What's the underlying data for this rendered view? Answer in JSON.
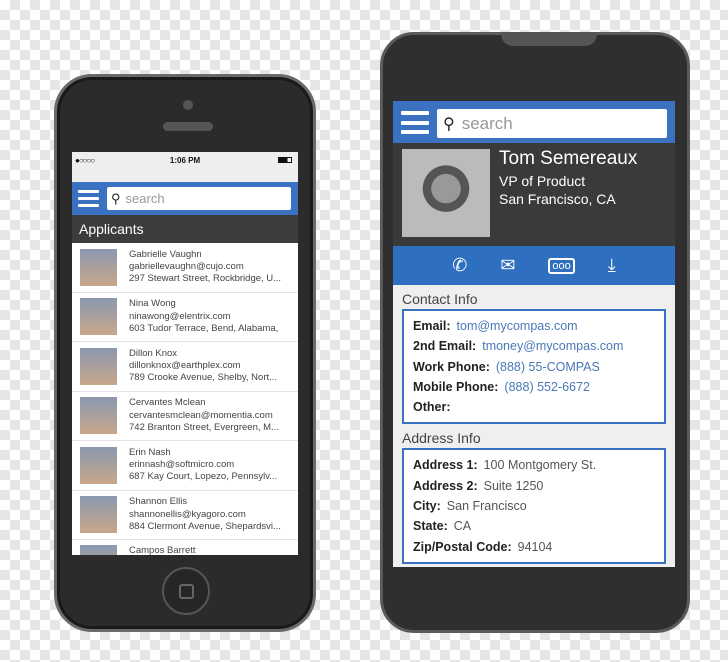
{
  "left_phone": {
    "status": {
      "time": "1:06 PM",
      "signal": "●○○○○"
    },
    "search": {
      "placeholder": "search"
    },
    "section_title": "Applicants",
    "applicants": [
      {
        "name": "Gabrielle Vaughn",
        "email": "gabriellevaughn@cujo.com",
        "address": "297 Stewart Street, Rockbridge, U..."
      },
      {
        "name": "Nina Wong",
        "email": "ninawong@elentrix.com",
        "address": "603 Tudor Terrace, Bend, Alabama,"
      },
      {
        "name": "Dillon Knox",
        "email": "dillonknox@earthplex.com",
        "address": "789 Crooke Avenue, Shelby, Nort..."
      },
      {
        "name": "Cervantes Mclean",
        "email": "cervantesmclean@momentia.com",
        "address": "742 Branton Street, Evergreen, M..."
      },
      {
        "name": "Erin Nash",
        "email": "erinnash@softmicro.com",
        "address": "687 Kay Court, Lopezo, Pennsylv..."
      },
      {
        "name": "Shannon Ellis",
        "email": "shannonellis@kyagoro.com",
        "address": "884 Clermont Avenue, Shepardsvi..."
      },
      {
        "name": "Campos Barrett",
        "email": "",
        "address": ""
      }
    ]
  },
  "right_phone": {
    "search": {
      "placeholder": "search"
    },
    "profile": {
      "name": "Tom Semereaux",
      "title": "VP of Product",
      "location": "San Francisco, CA"
    },
    "actions": [
      "phone-icon",
      "mail-icon",
      "chat-icon",
      "download-icon"
    ],
    "contact_title": "Contact Info",
    "contact": [
      {
        "label": "Email:",
        "value": "tom@mycompas.com"
      },
      {
        "label": "2nd Email:",
        "value": "tmoney@mycompas.com"
      },
      {
        "label": "Work Phone:",
        "value": "(888) 55-COMPAS"
      },
      {
        "label": "Mobile Phone:",
        "value": "(888) 552-6672"
      },
      {
        "label": "Other:",
        "value": ""
      }
    ],
    "address_title": "Address Info",
    "address": [
      {
        "label": "Address 1:",
        "value": "100 Montgomery St."
      },
      {
        "label": "Address 2:",
        "value": "Suite 1250"
      },
      {
        "label": "City:",
        "value": "San Francisco"
      },
      {
        "label": "State:",
        "value": "CA"
      },
      {
        "label": "Zip/Postal Code:",
        "value": "94104"
      }
    ]
  },
  "colors": {
    "primary": "#3a72c1",
    "dark": "#3a3a3a"
  }
}
